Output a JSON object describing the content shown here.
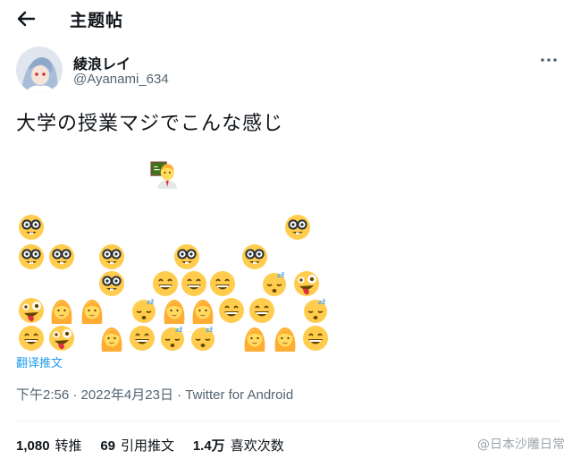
{
  "header": {
    "title": "主题帖"
  },
  "author": {
    "display_name": "綾浪レイ",
    "handle": "@Ayanami_634"
  },
  "tweet": {
    "text": "大学の授業マジでこんな感じ",
    "translate_label": "翻译推文",
    "time": "下午2:56",
    "separator": " · ",
    "date": "2022年4月23日",
    "source": "Twitter for Android"
  },
  "stats": [
    {
      "count": "1,080",
      "label": "转推"
    },
    {
      "count": "69",
      "label": "引用推文"
    },
    {
      "count": "1.4万",
      "label": "喜欢次数"
    }
  ],
  "watermark": "@日本沙雕日常",
  "emoji_grid": {
    "teacher": "teacher-emoji",
    "students": [
      "nerd-face",
      "nerd-face",
      "nerd-face",
      "nerd-face",
      "nerd-face",
      "nerd-face",
      "nerd-face",
      "nerd-face",
      "grinning-face",
      "grinning-face",
      "grinning-face",
      "sleeping-face",
      "zany-face",
      "zany-face",
      "woman",
      "woman",
      "sleeping-face",
      "woman",
      "woman",
      "grinning-face",
      "grinning-face",
      "sleeping-face",
      "grinning-face",
      "zany-face",
      "woman",
      "grinning-face",
      "sleeping-face",
      "sleeping-face",
      "woman",
      "woman",
      "grinning-face"
    ]
  },
  "colors": {
    "emoji_yellow": "#ffcc4d",
    "link_blue": "#1d9bf0",
    "muted": "#536471"
  }
}
